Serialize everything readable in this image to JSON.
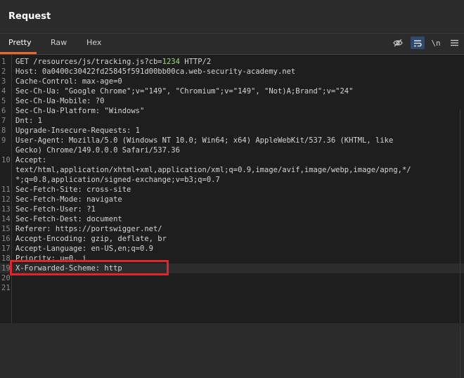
{
  "header": {
    "title": "Request"
  },
  "tabs": [
    {
      "label": "Pretty"
    },
    {
      "label": "Raw"
    },
    {
      "label": "Hex"
    }
  ],
  "toolbar": {
    "icons": [
      "eye-off-icon",
      "wrap-lines-icon",
      "newline-icon",
      "menu-icon"
    ],
    "newline_label": "\\n"
  },
  "lines": [
    {
      "n": "1",
      "text": "GET /resources/js/tracking.js?cb=",
      "num": "1234",
      "after": " HTTP/2"
    },
    {
      "n": "2",
      "text": "Host: 0a0400c30422fd25845f591d00bb00ca.web-security-academy.net"
    },
    {
      "n": "3",
      "text": "Cache-Control: max-age=0"
    },
    {
      "n": "4",
      "text": "Sec-Ch-Ua: \"Google Chrome\";v=\"149\", \"Chromium\";v=\"149\", \"Not)A;Brand\";v=\"24\""
    },
    {
      "n": "5",
      "text": "Sec-Ch-Ua-Mobile: ?0"
    },
    {
      "n": "6",
      "text": "Sec-Ch-Ua-Platform: \"Windows\""
    },
    {
      "n": "7",
      "text": "Dnt: 1"
    },
    {
      "n": "8",
      "text": "Upgrade-Insecure-Requests: 1"
    },
    {
      "n": "9",
      "text": "User-Agent: Mozilla/5.0 (Windows NT 10.0; Win64; x64) AppleWebKit/537.36 (KHTML, like"
    },
    {
      "n": "",
      "text": "Gecko) Chrome/149.0.0.0 Safari/537.36"
    },
    {
      "n": "10",
      "text": "Accept:"
    },
    {
      "n": "",
      "text": "text/html,application/xhtml+xml,application/xml;q=0.9,image/avif,image/webp,image/apng,*/"
    },
    {
      "n": "",
      "text": "*;q=0.8,application/signed-exchange;v=b3;q=0.7"
    },
    {
      "n": "11",
      "text": "Sec-Fetch-Site: cross-site"
    },
    {
      "n": "12",
      "text": "Sec-Fetch-Mode: navigate"
    },
    {
      "n": "13",
      "text": "Sec-Fetch-User: ?1"
    },
    {
      "n": "14",
      "text": "Sec-Fetch-Dest: document"
    },
    {
      "n": "15",
      "text": "Referer: https://portswigger.net/"
    },
    {
      "n": "16",
      "text": "Accept-Encoding: gzip, deflate, br"
    },
    {
      "n": "17",
      "text": "Accept-Language: en-US,en;q=0.9"
    },
    {
      "n": "18",
      "text": "Priority: u=0, i"
    },
    {
      "n": "19",
      "text": "X-Forwarded-Scheme: http"
    },
    {
      "n": "20",
      "text": ""
    },
    {
      "n": "21",
      "text": ""
    }
  ],
  "colors": {
    "accent": "#e8692b",
    "highlight_border": "#e0262b",
    "number": "#9cdc7c"
  }
}
